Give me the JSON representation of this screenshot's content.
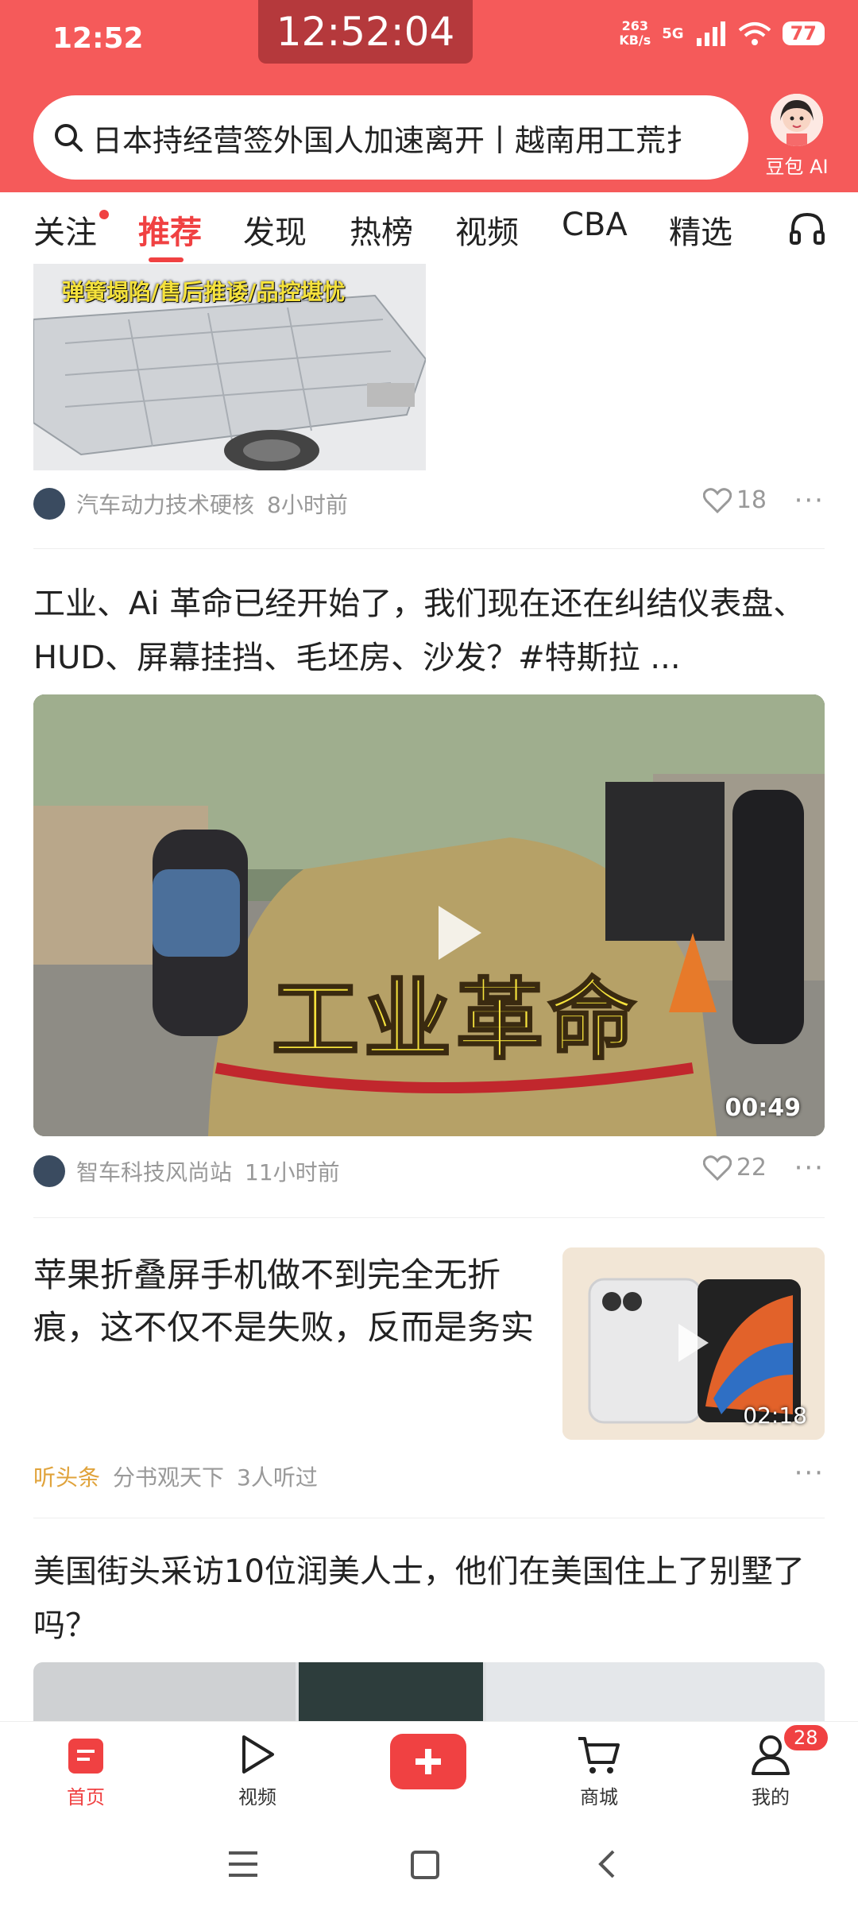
{
  "status_bar": {
    "time": "12:52",
    "clock_overlay": "12:52:04",
    "net_speed_value": "263",
    "net_speed_unit": "KB/s",
    "network": "5G",
    "battery": "77"
  },
  "search": {
    "text": "日本持经营签外国人加速离开丨越南用工荒扌"
  },
  "assistant": {
    "label": "豆包 AI"
  },
  "tabs": [
    "关注",
    "推荐",
    "发现",
    "热榜",
    "视频",
    "CBA",
    "精选"
  ],
  "feed": {
    "item1": {
      "thumb_caption": "弹簧塌陷/售后推诿/品控堪忧",
      "source": "汽车动力技术硬核",
      "time": "8小时前",
      "likes": "18"
    },
    "item2": {
      "title": "工业、Ai 革命已经开始了，我们现在还在纠结仪表盘、HUD、屏幕挂挡、毛坯房、沙发？#特斯拉 ...",
      "video_caption": "工业革命",
      "duration": "00:49",
      "source": "智车科技风尚站",
      "time": "11小时前",
      "likes": "22"
    },
    "item3": {
      "title": "苹果折叠屏手机做不到完全无折痕，这不仅不是失败，反而是务实",
      "duration": "02:18",
      "tag": "听头条",
      "source": "分书观天下",
      "listens": "3人听过"
    },
    "item4": {
      "title": "美国街头采访10位润美人士，他们在美国住上了别墅了吗？"
    }
  },
  "bottom_nav": {
    "home": "首页",
    "video": "视频",
    "mall": "商城",
    "me": "我的",
    "badge": "28"
  },
  "colors": {
    "brand_red": "#f04142",
    "header_red": "#f55a5a",
    "listen_tag": "#e0a33b"
  }
}
